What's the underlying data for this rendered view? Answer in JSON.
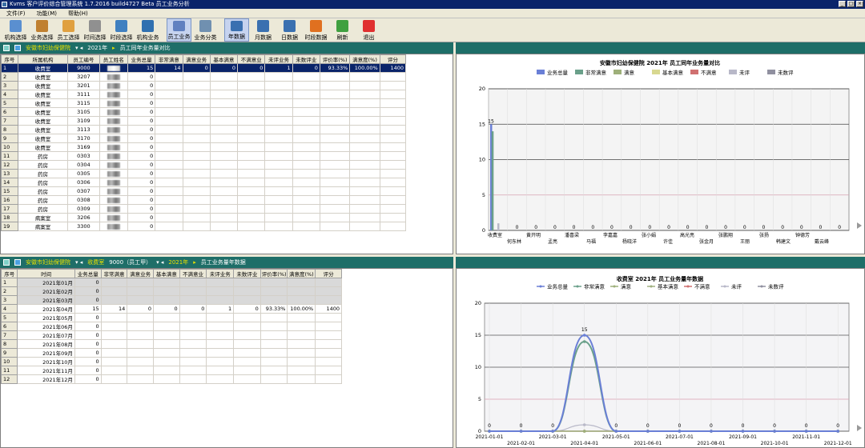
{
  "window": {
    "title": "Kvms 客户评价综合管理系统 1.7.2016 build4727 Beta 员工业务分析"
  },
  "menu": [
    {
      "label": "文件(F)"
    },
    {
      "label": "功能(M)"
    },
    {
      "label": "帮助(H)"
    }
  ],
  "toolbar": [
    {
      "label": "机构选择",
      "icon": "building-search-icon",
      "color": "#5a8fd0"
    },
    {
      "label": "业务选择",
      "icon": "book-icon",
      "color": "#c08030"
    },
    {
      "label": "员工选择",
      "icon": "people-icon",
      "color": "#e0a040"
    },
    {
      "label": "时间选择",
      "icon": "clock-icon",
      "color": "#909090"
    },
    {
      "label": "时段选择",
      "icon": "calendar-icon",
      "color": "#4080c0"
    },
    {
      "label": "机构业务",
      "icon": "org-chart-icon",
      "color": "#3070b0"
    },
    {
      "label": "员工业务",
      "icon": "employee-doc-icon",
      "color": "#6080c0",
      "active": true
    },
    {
      "label": "业务分类",
      "icon": "doc-copy-icon",
      "color": "#7090b0"
    },
    {
      "label": "年数据",
      "icon": "year-data-icon",
      "color": "#3a70b0",
      "active": true
    },
    {
      "label": "月数据",
      "icon": "month-data-icon",
      "color": "#3a70b0"
    },
    {
      "label": "日数据",
      "icon": "day-data-icon",
      "color": "#3a70b0"
    },
    {
      "label": "时段数据",
      "icon": "period-data-icon",
      "color": "#e07020"
    },
    {
      "label": "刷新",
      "icon": "refresh-icon",
      "color": "#40a040"
    },
    {
      "label": "退出",
      "icon": "exit-icon",
      "color": "#e03030"
    }
  ],
  "top_bar": {
    "org": "安徽市妇幼保健院",
    "year": "2021年",
    "view": "员工同年业务量对比"
  },
  "bottom_bar": {
    "org": "安徽市妇幼保健院",
    "dept": "收费室",
    "employee": "9000（员工甲）",
    "year": "2021年",
    "view": "员工业务量年数据"
  },
  "top_table": {
    "headers": [
      "序号",
      "所属机构",
      "员工编号",
      "员工姓名",
      "业务总量",
      "非常满意",
      "满意业务",
      "基本满意",
      "不满意业",
      "未评业务",
      "未数评业",
      "评价率(%)",
      "满意度(%)",
      "评分"
    ],
    "rows": [
      [
        "1",
        "收费室",
        "9000",
        "",
        "15",
        "14",
        "0",
        "0",
        "0",
        "1",
        "0",
        "93.33%",
        "100.00%",
        "1400"
      ],
      [
        "2",
        "收费室",
        "3207",
        "",
        "0",
        "",
        "",
        "",
        "",
        "",
        "",
        "",
        "",
        ""
      ],
      [
        "3",
        "收费室",
        "3201",
        "",
        "0",
        "",
        "",
        "",
        "",
        "",
        "",
        "",
        "",
        ""
      ],
      [
        "4",
        "收费室",
        "3111",
        "",
        "0",
        "",
        "",
        "",
        "",
        "",
        "",
        "",
        "",
        ""
      ],
      [
        "5",
        "收费室",
        "3115",
        "",
        "0",
        "",
        "",
        "",
        "",
        "",
        "",
        "",
        "",
        ""
      ],
      [
        "6",
        "收费室",
        "3105",
        "",
        "0",
        "",
        "",
        "",
        "",
        "",
        "",
        "",
        "",
        ""
      ],
      [
        "7",
        "收费室",
        "3109",
        "",
        "0",
        "",
        "",
        "",
        "",
        "",
        "",
        "",
        "",
        ""
      ],
      [
        "8",
        "收费室",
        "3113",
        "",
        "0",
        "",
        "",
        "",
        "",
        "",
        "",
        "",
        "",
        ""
      ],
      [
        "9",
        "收费室",
        "3170",
        "",
        "0",
        "",
        "",
        "",
        "",
        "",
        "",
        "",
        "",
        ""
      ],
      [
        "10",
        "收费室",
        "3169",
        "",
        "0",
        "",
        "",
        "",
        "",
        "",
        "",
        "",
        "",
        ""
      ],
      [
        "11",
        "药房",
        "0303",
        "",
        "0",
        "",
        "",
        "",
        "",
        "",
        "",
        "",
        "",
        ""
      ],
      [
        "12",
        "药房",
        "0304",
        "",
        "0",
        "",
        "",
        "",
        "",
        "",
        "",
        "",
        "",
        ""
      ],
      [
        "13",
        "药房",
        "0305",
        "",
        "0",
        "",
        "",
        "",
        "",
        "",
        "",
        "",
        "",
        ""
      ],
      [
        "14",
        "药房",
        "0306",
        "",
        "0",
        "",
        "",
        "",
        "",
        "",
        "",
        "",
        "",
        ""
      ],
      [
        "15",
        "药房",
        "0307",
        "",
        "0",
        "",
        "",
        "",
        "",
        "",
        "",
        "",
        "",
        ""
      ],
      [
        "16",
        "药房",
        "0308",
        "",
        "0",
        "",
        "",
        "",
        "",
        "",
        "",
        "",
        "",
        ""
      ],
      [
        "17",
        "药房",
        "0309",
        "",
        "0",
        "",
        "",
        "",
        "",
        "",
        "",
        "",
        "",
        ""
      ],
      [
        "18",
        "病案室",
        "3206",
        "",
        "0",
        "",
        "",
        "",
        "",
        "",
        "",
        "",
        "",
        ""
      ],
      [
        "19",
        "病案室",
        "3300",
        "",
        "0",
        "",
        "",
        "",
        "",
        "",
        "",
        "",
        "",
        ""
      ]
    ]
  },
  "bottom_table": {
    "headers": [
      "序号",
      "时间",
      "业务总量",
      "非常满意",
      "满意业务",
      "基本满意",
      "不满意业",
      "未评业务",
      "未数评业",
      "评价率(%)",
      "满意度(%)",
      "评分"
    ],
    "rows": [
      [
        "1",
        "2021年01月",
        "0",
        "",
        "",
        "",
        "",
        "",
        "",
        "",
        "",
        ""
      ],
      [
        "2",
        "2021年02月",
        "0",
        "",
        "",
        "",
        "",
        "",
        "",
        "",
        "",
        ""
      ],
      [
        "3",
        "2021年03月",
        "0",
        "",
        "",
        "",
        "",
        "",
        "",
        "",
        "",
        ""
      ],
      [
        "4",
        "2021年04月",
        "15",
        "14",
        "0",
        "0",
        "0",
        "1",
        "0",
        "93.33%",
        "100.00%",
        "1400"
      ],
      [
        "5",
        "2021年05月",
        "0",
        "",
        "",
        "",
        "",
        "",
        "",
        "",
        "",
        ""
      ],
      [
        "6",
        "2021年06月",
        "0",
        "",
        "",
        "",
        "",
        "",
        "",
        "",
        "",
        ""
      ],
      [
        "7",
        "2021年07月",
        "0",
        "",
        "",
        "",
        "",
        "",
        "",
        "",
        "",
        ""
      ],
      [
        "8",
        "2021年08月",
        "0",
        "",
        "",
        "",
        "",
        "",
        "",
        "",
        "",
        ""
      ],
      [
        "9",
        "2021年09月",
        "0",
        "",
        "",
        "",
        "",
        "",
        "",
        "",
        "",
        ""
      ],
      [
        "10",
        "2021年10月",
        "0",
        "",
        "",
        "",
        "",
        "",
        "",
        "",
        "",
        ""
      ],
      [
        "11",
        "2021年11月",
        "0",
        "",
        "",
        "",
        "",
        "",
        "",
        "",
        "",
        ""
      ],
      [
        "12",
        "2021年12月",
        "0",
        "",
        "",
        "",
        "",
        "",
        "",
        "",
        "",
        ""
      ]
    ]
  },
  "chart_data": [
    {
      "type": "bar",
      "title": "安徽市妇幼保健院 2021年 员工同年业务量对比",
      "legend": [
        "业务总量",
        "非常满意",
        "满意",
        "基本满意",
        "不满意",
        "未评",
        "未数评"
      ],
      "legend_colors": [
        "#6a7fd6",
        "#6aa08a",
        "#9eb07a",
        "#d8d890",
        "#d07070",
        "#b8b8c8",
        "#9090a0"
      ],
      "categories": [
        "收费室",
        "",
        "",
        "",
        "",
        "",
        "",
        "",
        "",
        "",
        "",
        "",
        "",
        "",
        "",
        "",
        "",
        "",
        ""
      ],
      "category_labels_row1": [
        "收费室",
        "黄开明",
        "潘喜梁",
        "李嘉嘉",
        "张小娟",
        "高光亮",
        "张鹏翔",
        "张扬",
        "钟德芳",
        "",
        ""
      ],
      "category_labels_row2": [
        "何东林",
        "孟亮",
        "马福",
        "杨晓洋",
        "许佳",
        "张金月",
        "王丽",
        "韩建文",
        "戴云峰",
        "",
        ""
      ],
      "values_first": [
        15,
        14,
        0,
        0,
        0,
        1,
        0
      ],
      "zero_labels": [
        "0",
        "0",
        "0",
        "0",
        "0",
        "0",
        "0",
        "0",
        "0",
        "0",
        "0",
        "0",
        "0",
        "0",
        "0",
        "0",
        "0",
        "0"
      ],
      "bar_label": "15",
      "ylim": [
        0,
        20
      ],
      "yticks": [
        "0",
        "5",
        "10",
        "15",
        "20"
      ],
      "legend_position": "top"
    },
    {
      "type": "line",
      "title": "收费室 2021年 员工业务量年数据",
      "legend": [
        "业务总量",
        "非常满意",
        "满意",
        "基本满意",
        "不满意",
        "未评",
        "未数评"
      ],
      "legend_colors": [
        "#6a7fd6",
        "#6aa08a",
        "#9eb07a",
        "#a0b080",
        "#d07070",
        "#b8b8c8",
        "#9090a0"
      ],
      "x": [
        "2021-01-01",
        "2021-02-01",
        "2021-03-01",
        "2021-04-01",
        "2021-05-01",
        "2021-06-01",
        "2021-07-01",
        "2021-08-01",
        "2021-09-01",
        "2021-10-01",
        "2021-11-01",
        "2021-12-01"
      ],
      "series": [
        {
          "name": "业务总量",
          "values": [
            0,
            0,
            0,
            15,
            0,
            0,
            0,
            0,
            0,
            0,
            0,
            0
          ]
        },
        {
          "name": "非常满意",
          "values": [
            0,
            0,
            0,
            14,
            0,
            0,
            0,
            0,
            0,
            0,
            0,
            0
          ]
        },
        {
          "name": "满意",
          "values": [
            0,
            0,
            0,
            0,
            0,
            0,
            0,
            0,
            0,
            0,
            0,
            0
          ]
        },
        {
          "name": "基本满意",
          "values": [
            0,
            0,
            0,
            0,
            0,
            0,
            0,
            0,
            0,
            0,
            0,
            0
          ]
        },
        {
          "name": "不满意",
          "values": [
            0,
            0,
            0,
            0,
            0,
            0,
            0,
            0,
            0,
            0,
            0,
            0
          ]
        },
        {
          "name": "未评",
          "values": [
            0,
            0,
            0,
            1,
            0,
            0,
            0,
            0,
            0,
            0,
            0,
            0
          ]
        },
        {
          "name": "未数评",
          "values": [
            0,
            0,
            0,
            0,
            0,
            0,
            0,
            0,
            0,
            0,
            0,
            0
          ]
        }
      ],
      "point_labels": [
        "0",
        "0",
        "0",
        "15",
        "0",
        "0",
        "0",
        "0",
        "0",
        "0",
        "0",
        "0"
      ],
      "ylim": [
        0,
        20
      ],
      "yticks": [
        "0",
        "5",
        "10",
        "15",
        "20"
      ],
      "legend_position": "top"
    }
  ]
}
